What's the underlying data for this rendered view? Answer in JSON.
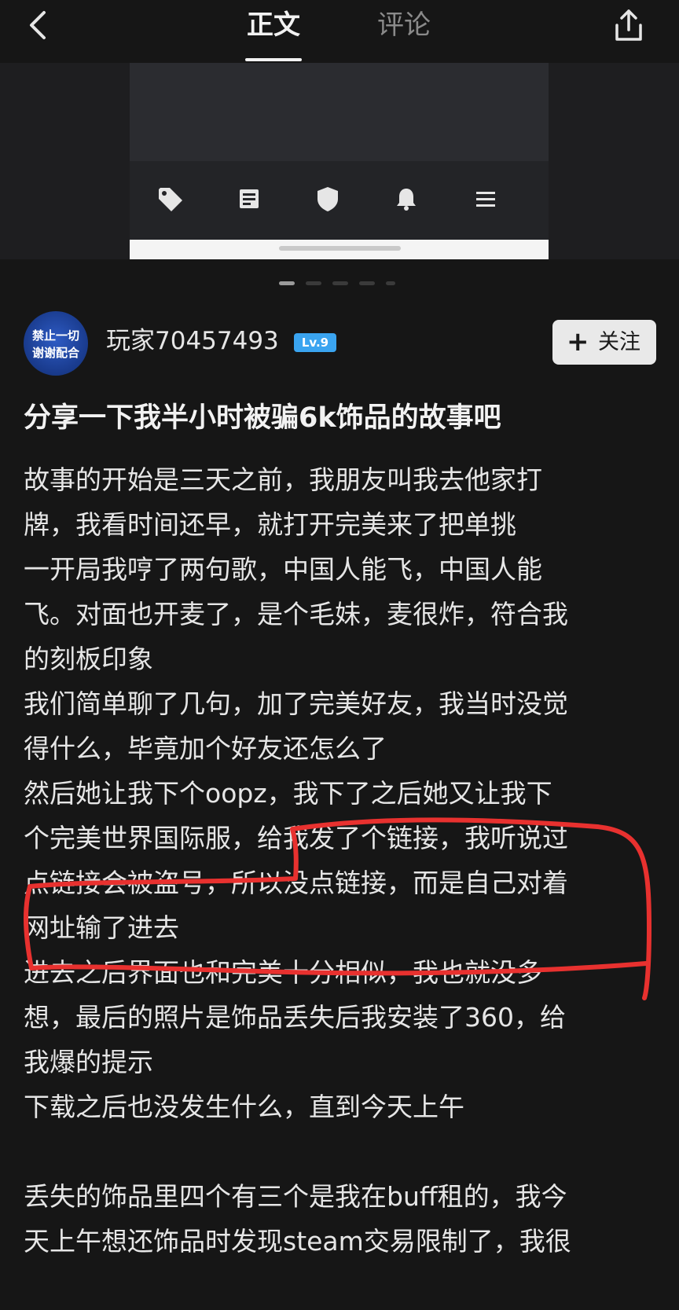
{
  "header": {
    "tabs": [
      {
        "label": "正文",
        "active": true
      },
      {
        "label": "评论",
        "active": false
      }
    ],
    "back_icon": "chevron-left-icon",
    "share_icon": "share-icon"
  },
  "media": {
    "nav_icons": [
      "tag-icon",
      "article-icon",
      "shield-icon",
      "bell-icon",
      "menu-icon"
    ],
    "pages": 5,
    "current_page": 1
  },
  "author": {
    "avatar_text": [
      "禁止一切",
      "谢谢配合"
    ],
    "name": "玩家70457493",
    "level": "Lv.9",
    "follow_label": "关注"
  },
  "post": {
    "title": "分享一下我半小时被骗6k饰品的故事吧",
    "lines": [
      "故事的开始是三天之前，我朋友叫我去他家打",
      "牌，我看时间还早，就打开完美来了把单挑",
      "一开局我哼了两句歌，中国人能飞，中国人能",
      "飞。对面也开麦了，是个毛妹，麦很炸，符合我",
      "的刻板印象",
      "我们简单聊了几句，加了完美好友，我当时没觉",
      "得什么，毕竟加个好友还怎么了",
      "然后她让我下个oopz，我下了之后她又让我下",
      "个完美世界国际服，给我发了个链接，我听说过",
      "点链接会被盗号，所以没点链接，而是自己对着",
      "网址输了进去",
      "进去之后界面也和完美十分相似，我也就没多",
      "想，最后的照片是饰品丢失后我安装了360，给",
      "我爆的提示",
      "下载之后也没发生什么，直到今天上午",
      "",
      "丢失的饰品里四个有三个是我在buff租的，我今",
      "天上午想还饰品时发现steam交易限制了，我很"
    ]
  },
  "colors": {
    "background": "#161616",
    "text": "#e6e6e6",
    "level_badge": "#3aa4f0",
    "annotation_red": "#e8312f"
  }
}
